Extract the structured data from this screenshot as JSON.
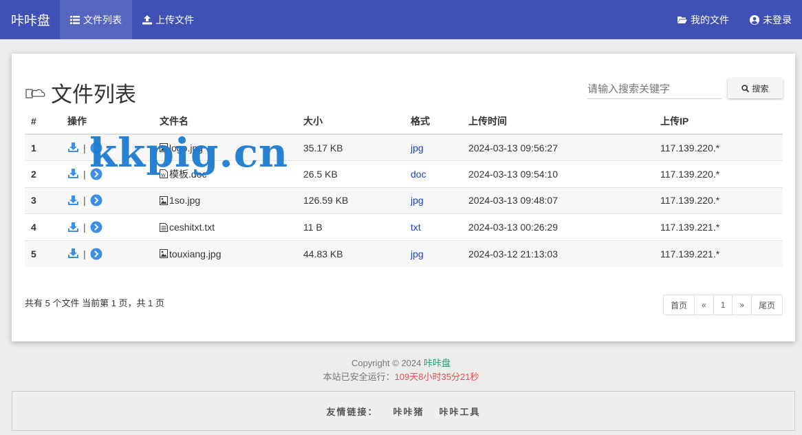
{
  "nav": {
    "brand": "咔咔盘",
    "file_list": "文件列表",
    "upload": "上传文件",
    "my_files": "我的文件",
    "not_logged_in": "未登录",
    "accent_color": "#3f51b5"
  },
  "main": {
    "title": "文件列表",
    "search": {
      "placeholder": "请输入搜索关键字",
      "button_label": "搜索"
    },
    "columns": [
      "#",
      "操作",
      "文件名",
      "大小",
      "格式",
      "上传时间",
      "上传IP"
    ],
    "rows": [
      {
        "idx": "1",
        "name": "logo.jpg",
        "size": "35.17 KB",
        "fmt": "jpg",
        "time": "2024-03-13 09:56:27",
        "ip": "117.139.220.*",
        "icon": "image-file-icon"
      },
      {
        "idx": "2",
        "name": "模板.doc",
        "size": "26.5 KB",
        "fmt": "doc",
        "time": "2024-03-13 09:54:10",
        "ip": "117.139.220.*",
        "icon": "word-file-icon"
      },
      {
        "idx": "3",
        "name": "1so.jpg",
        "size": "126.59 KB",
        "fmt": "jpg",
        "time": "2024-03-13 09:48:07",
        "ip": "117.139.220.*",
        "icon": "image-file-icon"
      },
      {
        "idx": "4",
        "name": "ceshitxt.txt",
        "size": "11 B",
        "fmt": "txt",
        "time": "2024-03-13 00:26:29",
        "ip": "117.139.221.*",
        "icon": "text-file-icon"
      },
      {
        "idx": "5",
        "name": "touxiang.jpg",
        "size": "44.83 KB",
        "fmt": "jpg",
        "time": "2024-03-12 21:13:03",
        "ip": "117.139.221.*",
        "icon": "image-file-icon"
      }
    ],
    "summary": "共有 5 个文件  当前第 1 页，共 1 页",
    "pager": [
      "首页",
      "«",
      "1",
      "»",
      "尾页"
    ]
  },
  "footer": {
    "copyright": "Copyright © 2024",
    "site_name": "咔咔盘",
    "runtime_label": "本站已安全运行：",
    "runtime_value": "109天8小时35分21秒",
    "links_label": "友情链接：",
    "links": [
      "咔咔猪",
      "咔咔工具"
    ]
  },
  "watermark": "kkpig.cn"
}
